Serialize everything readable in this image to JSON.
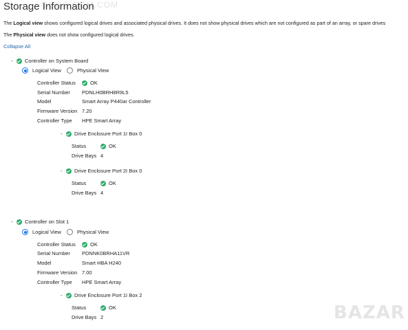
{
  "page_title": "Storage Information",
  "watermark_top": "GOGO.COM.COM",
  "watermark_bottom": "BAZAR",
  "description_1": {
    "prefix": "The ",
    "bold": "Logical view",
    "rest": " shows configured logical drives and associated physical drives. It does not show physical drives which are not configured as part of an array, or spare drives"
  },
  "description_2": {
    "prefix": "The ",
    "bold": "Physical view",
    "rest": " does not show configured logical drives."
  },
  "collapse_all": "Collapse All",
  "labels": {
    "controller_status": "Controller Status",
    "serial_number": "Serial Number",
    "model": "Model",
    "firmware_version": "Firmware Version",
    "controller_type": "Controller Type",
    "status": "Status",
    "drive_bays": "Drive Bays",
    "logical_view": "Logical View",
    "physical_view": "Physical View",
    "expander": "-"
  },
  "controllers": [
    {
      "name": "Controller on System Board",
      "selected_view": "Logical View",
      "status": "OK",
      "serial": "PDNLH0BRH8R9L5",
      "model": "Smart Array P440ar Controller",
      "firmware": "7.20",
      "type": "HPE Smart Array",
      "enclosures": [
        {
          "name": "Drive Enclosure Port 1I Box 0",
          "status": "OK",
          "bays": "4"
        },
        {
          "name": "Drive Enclosure Port 2I Box 0",
          "status": "OK",
          "bays": "4"
        }
      ]
    },
    {
      "name": "Controller on Slot 1",
      "selected_view": "Logical View",
      "status": "OK",
      "serial": "PDNNK0BRHA11VR",
      "model": "Smart HBA H240",
      "firmware": "7.00",
      "type": "HPE Smart Array",
      "enclosures": [
        {
          "name": "Drive Enclosure Port 1I Box 2",
          "status": "OK",
          "bays": "2"
        }
      ]
    }
  ],
  "colors": {
    "ok_green": "#2bab6a",
    "link_blue": "#2266aa",
    "radio_blue": "#1a73e8"
  }
}
